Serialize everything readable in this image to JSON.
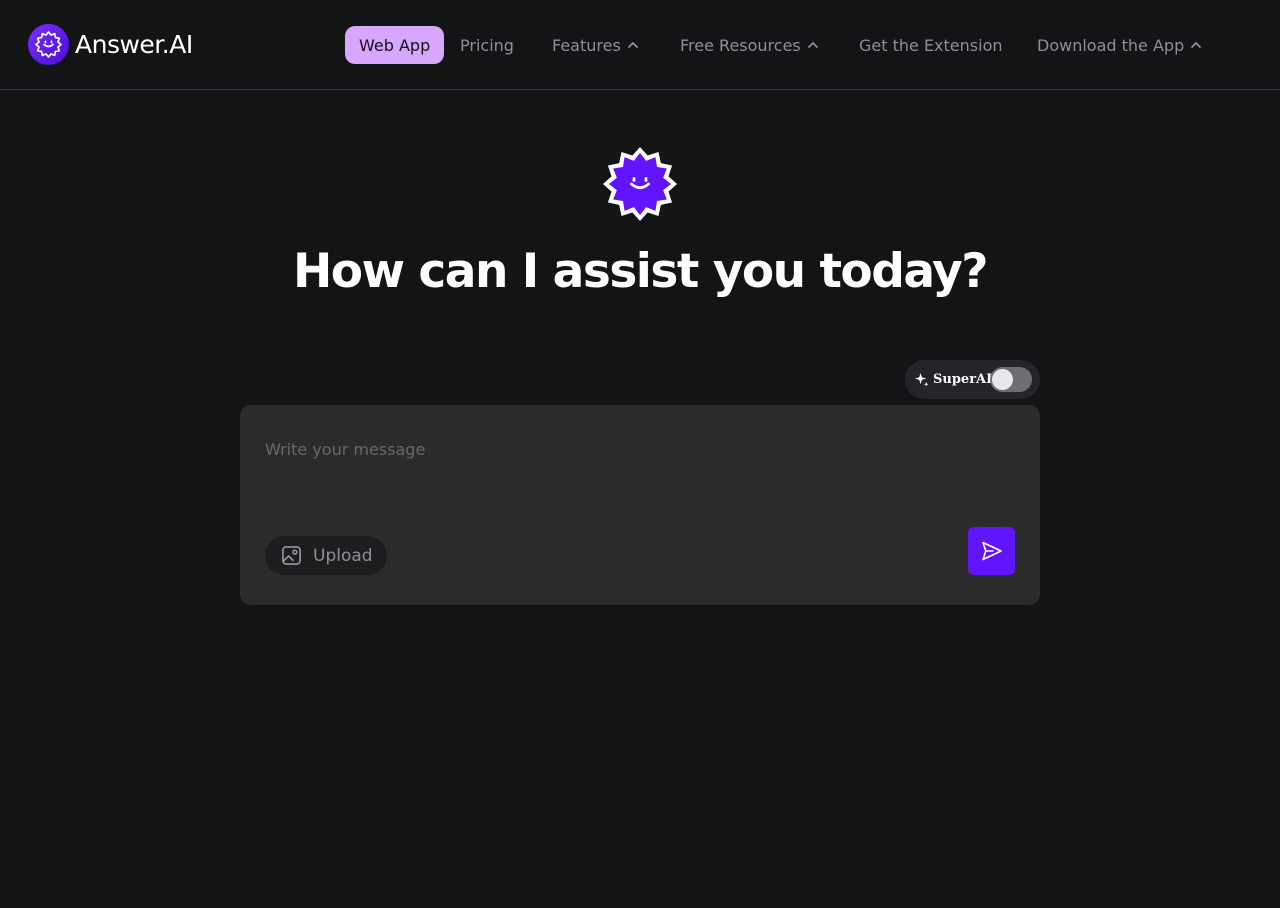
{
  "brand": {
    "name": "Answer.AI",
    "logo_icon": "starburst-smile-logo",
    "accent": "#6314ff"
  },
  "nav": {
    "items": [
      {
        "label": "Web App",
        "active": true
      },
      {
        "label": "Pricing"
      },
      {
        "label": "Features",
        "icon": "chevron-up-icon"
      },
      {
        "label": "Free Resources",
        "icon": "chevron-up-icon"
      },
      {
        "label": "Get the Extension"
      },
      {
        "label": "Download the App",
        "icon": "chevron-up-icon"
      }
    ],
    "active_color": "#d7a6ff"
  },
  "hero": {
    "heading": "How can I assist you today?"
  },
  "superai": {
    "label": "SuperAI",
    "enabled": false,
    "icon": "sparkle-icon"
  },
  "composer": {
    "placeholder": "Write your message",
    "value": "",
    "upload_label": "Upload",
    "upload_icon": "image-upload-icon",
    "send_icon": "send-icon"
  },
  "colors": {
    "background": "#131416",
    "composer_bg": "#2b2b2c",
    "send_button": "#6314ff"
  }
}
